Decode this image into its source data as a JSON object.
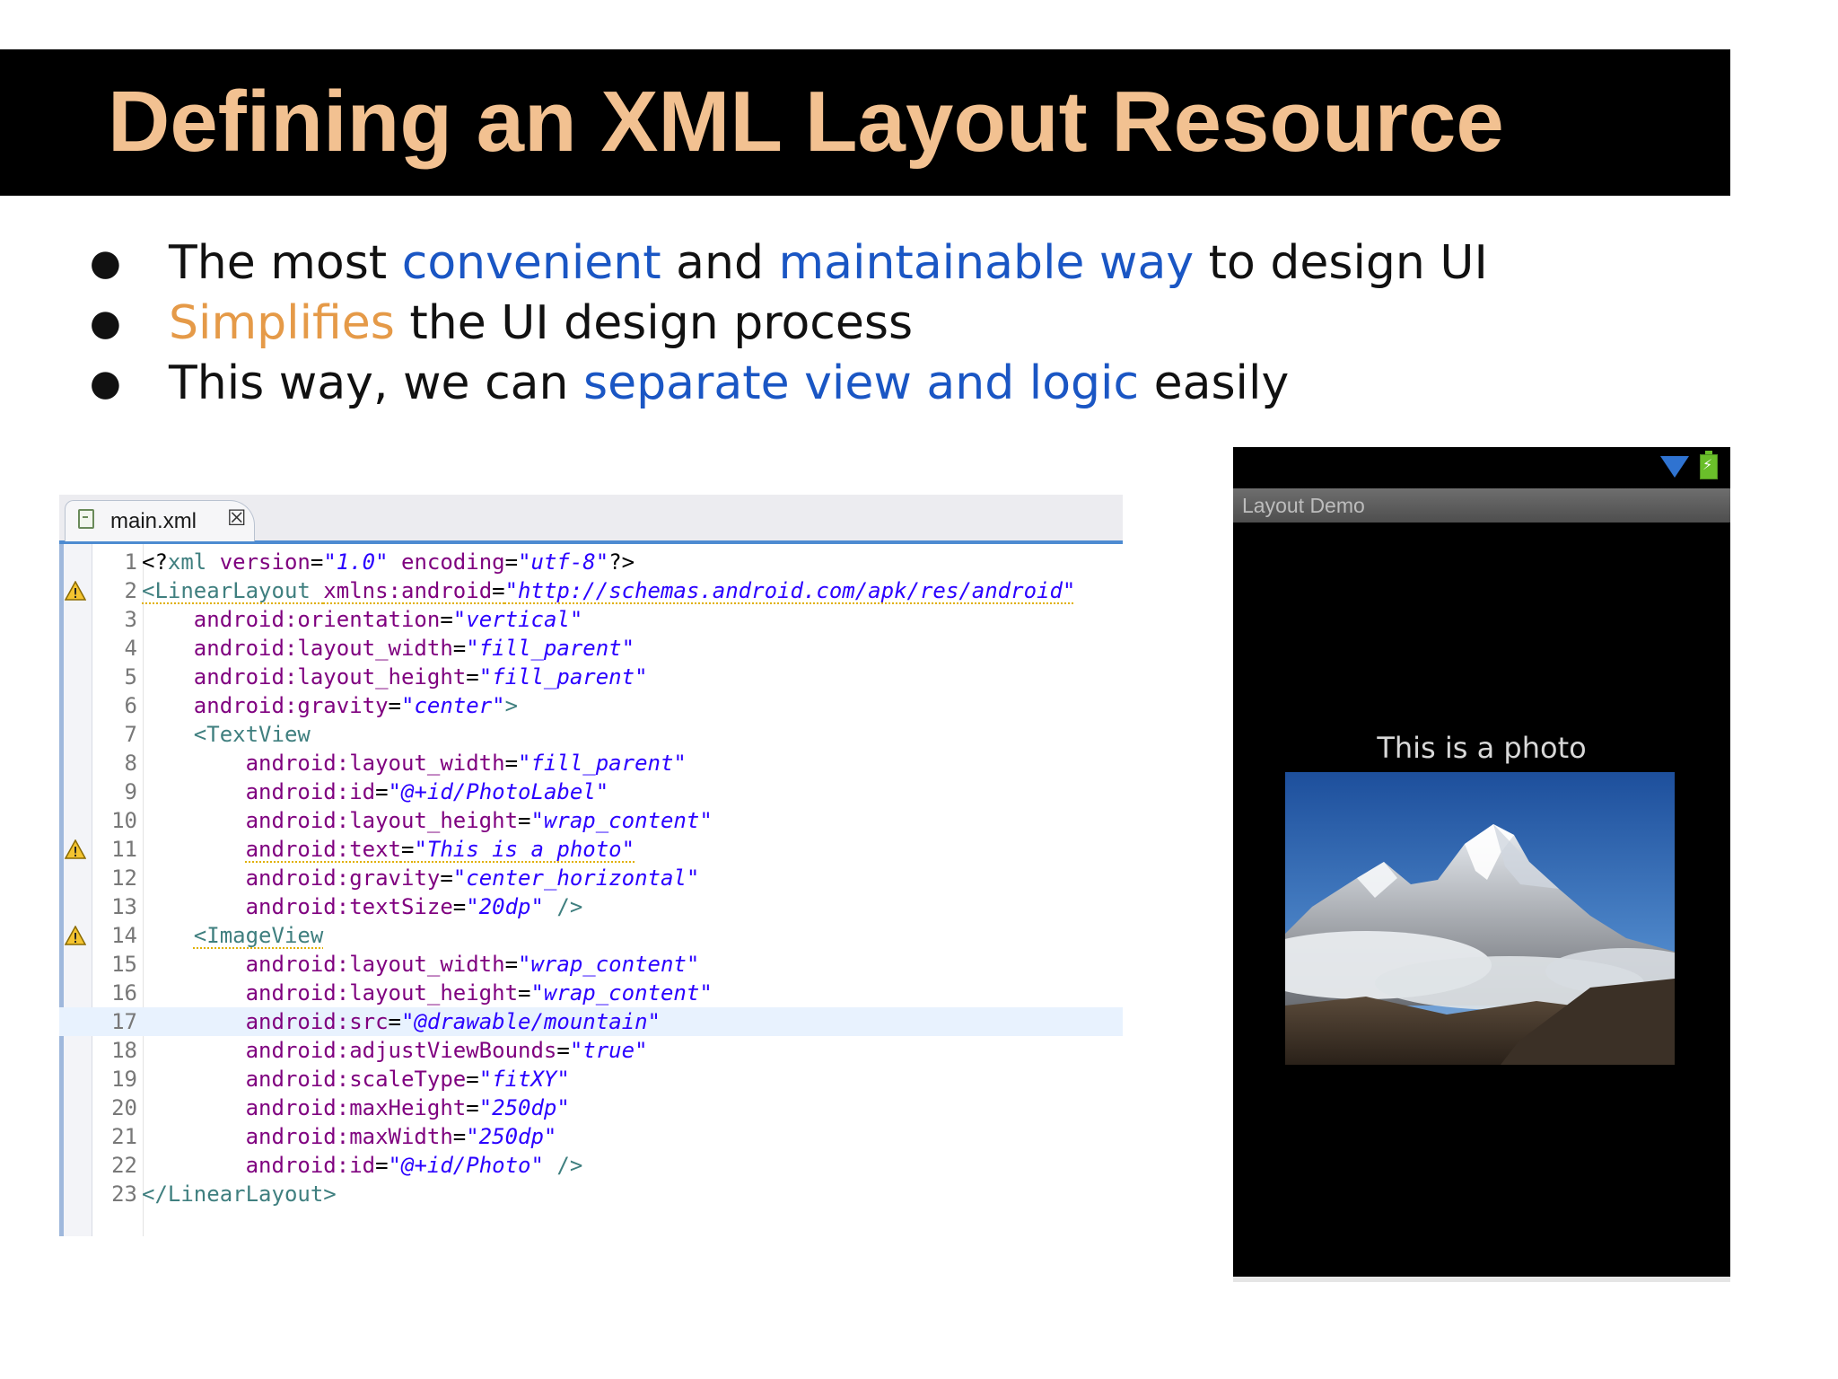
{
  "slide": {
    "title": "Defining an XML Layout Resource",
    "bullets": [
      {
        "parts": [
          {
            "text": "The most ",
            "style": "normal"
          },
          {
            "text": "convenient",
            "style": "blue"
          },
          {
            "text": " and ",
            "style": "normal"
          },
          {
            "text": "maintainable way",
            "style": "blue"
          },
          {
            "text": " to design UI",
            "style": "normal"
          }
        ]
      },
      {
        "parts": [
          {
            "text": "Simplifies",
            "style": "orange"
          },
          {
            "text": " the UI design process",
            "style": "normal"
          }
        ]
      },
      {
        "parts": [
          {
            "text": "This way, we can ",
            "style": "normal"
          },
          {
            "text": "separate view and logic",
            "style": "blue"
          },
          {
            "text": " easily",
            "style": "normal"
          }
        ]
      }
    ]
  },
  "editor": {
    "tab_label": "main.xml",
    "tab_close_glyph": "☒",
    "active_line": 17,
    "lines": [
      {
        "n": "1",
        "warn": false,
        "indent": 0,
        "tokens": [
          [
            "pun",
            "<?"
          ],
          [
            "tag",
            "xml "
          ],
          [
            "attr",
            "version"
          ],
          [
            "pun",
            "="
          ],
          [
            "str",
            "\"1.0\""
          ],
          [
            "attr",
            " encoding"
          ],
          [
            "pun",
            "="
          ],
          [
            "str",
            "\"utf-8\""
          ],
          [
            "pun",
            "?>"
          ]
        ]
      },
      {
        "n": "2",
        "warn": true,
        "indent": 0,
        "tokens": [
          [
            "tagw",
            "<LinearLayout "
          ],
          [
            "attrw",
            "xmlns:android"
          ],
          [
            "punw",
            "="
          ],
          [
            "strw",
            "\"http://schemas.android.com/apk/res/android\""
          ]
        ]
      },
      {
        "n": "3",
        "warn": false,
        "indent": 4,
        "tokens": [
          [
            "attr",
            "android:orientation"
          ],
          [
            "pun",
            "="
          ],
          [
            "str",
            "\"vertical\""
          ]
        ]
      },
      {
        "n": "4",
        "warn": false,
        "indent": 4,
        "tokens": [
          [
            "attr",
            "android:layout_width"
          ],
          [
            "pun",
            "="
          ],
          [
            "str",
            "\"fill_parent\""
          ]
        ]
      },
      {
        "n": "5",
        "warn": false,
        "indent": 4,
        "tokens": [
          [
            "attr",
            "android:layout_height"
          ],
          [
            "pun",
            "="
          ],
          [
            "str",
            "\"fill_parent\""
          ]
        ]
      },
      {
        "n": "6",
        "warn": false,
        "indent": 4,
        "tokens": [
          [
            "attr",
            "android:gravity"
          ],
          [
            "pun",
            "="
          ],
          [
            "str",
            "\"center\""
          ],
          [
            "tag",
            ">"
          ]
        ]
      },
      {
        "n": "7",
        "warn": false,
        "indent": 4,
        "tokens": [
          [
            "tag",
            "<TextView"
          ]
        ]
      },
      {
        "n": "8",
        "warn": false,
        "indent": 8,
        "tokens": [
          [
            "attr",
            "android:layout_width"
          ],
          [
            "pun",
            "="
          ],
          [
            "str",
            "\"fill_parent\""
          ]
        ]
      },
      {
        "n": "9",
        "warn": false,
        "indent": 8,
        "tokens": [
          [
            "attr",
            "android:id"
          ],
          [
            "pun",
            "="
          ],
          [
            "str",
            "\"@+id/PhotoLabel\""
          ]
        ]
      },
      {
        "n": "10",
        "warn": false,
        "indent": 8,
        "tokens": [
          [
            "attr",
            "android:layout_height"
          ],
          [
            "pun",
            "="
          ],
          [
            "str",
            "\"wrap_content\""
          ]
        ]
      },
      {
        "n": "11",
        "warn": true,
        "indent": 8,
        "tokens": [
          [
            "attrw",
            "android:text"
          ],
          [
            "punw",
            "="
          ],
          [
            "strw",
            "\"This is a photo\""
          ]
        ]
      },
      {
        "n": "12",
        "warn": false,
        "indent": 8,
        "tokens": [
          [
            "attr",
            "android:gravity"
          ],
          [
            "pun",
            "="
          ],
          [
            "str",
            "\"center_horizontal\""
          ]
        ]
      },
      {
        "n": "13",
        "warn": false,
        "indent": 8,
        "tokens": [
          [
            "attr",
            "android:textSize"
          ],
          [
            "pun",
            "="
          ],
          [
            "str",
            "\"20dp\""
          ],
          [
            "tag",
            " />"
          ]
        ]
      },
      {
        "n": "14",
        "warn": true,
        "indent": 4,
        "tokens": [
          [
            "tagw",
            "<ImageView"
          ]
        ]
      },
      {
        "n": "15",
        "warn": false,
        "indent": 8,
        "tokens": [
          [
            "attr",
            "android:layout_width"
          ],
          [
            "pun",
            "="
          ],
          [
            "str",
            "\"wrap_content\""
          ]
        ]
      },
      {
        "n": "16",
        "warn": false,
        "indent": 8,
        "tokens": [
          [
            "attr",
            "android:layout_height"
          ],
          [
            "pun",
            "="
          ],
          [
            "str",
            "\"wrap_content\""
          ]
        ]
      },
      {
        "n": "17",
        "warn": false,
        "indent": 8,
        "tokens": [
          [
            "attr",
            "android:src"
          ],
          [
            "pun",
            "="
          ],
          [
            "str",
            "\"@drawable/mountain\""
          ]
        ]
      },
      {
        "n": "18",
        "warn": false,
        "indent": 8,
        "tokens": [
          [
            "attr",
            "android:adjustViewBounds"
          ],
          [
            "pun",
            "="
          ],
          [
            "str",
            "\"true\""
          ]
        ]
      },
      {
        "n": "19",
        "warn": false,
        "indent": 8,
        "tokens": [
          [
            "attr",
            "android:scaleType"
          ],
          [
            "pun",
            "="
          ],
          [
            "str",
            "\"fitXY\""
          ]
        ]
      },
      {
        "n": "20",
        "warn": false,
        "indent": 8,
        "tokens": [
          [
            "attr",
            "android:maxHeight"
          ],
          [
            "pun",
            "="
          ],
          [
            "str",
            "\"250dp\""
          ]
        ]
      },
      {
        "n": "21",
        "warn": false,
        "indent": 8,
        "tokens": [
          [
            "attr",
            "android:maxWidth"
          ],
          [
            "pun",
            "="
          ],
          [
            "str",
            "\"250dp\""
          ]
        ]
      },
      {
        "n": "22",
        "warn": false,
        "indent": 8,
        "tokens": [
          [
            "attr",
            "android:id"
          ],
          [
            "pun",
            "="
          ],
          [
            "str",
            "\"@+id/Photo\""
          ],
          [
            "tag",
            " />"
          ]
        ]
      },
      {
        "n": "23",
        "warn": false,
        "indent": 0,
        "tokens": [
          [
            "tag",
            "</LinearLayout>"
          ]
        ]
      }
    ]
  },
  "phone": {
    "app_title": "Layout Demo",
    "photo_label": "This is a photo",
    "photo_icon": "mountain-photo",
    "icons": [
      "wifi-icon",
      "battery-icon"
    ]
  },
  "colors": {
    "title_bg": "#000000",
    "title_text": "#f2c191",
    "highlight_blue": "#1a56c4",
    "highlight_orange": "#e59a48"
  }
}
